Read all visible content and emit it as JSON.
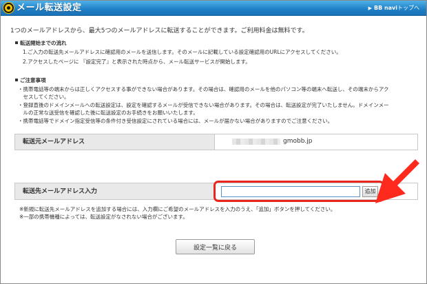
{
  "window": {
    "title": "メール転送設定",
    "top_link": {
      "arrow": "▶",
      "brand": "BB navi",
      "suffix": "トップへ"
    }
  },
  "intro": "1つのメールアドレスから、最大5つのメールアドレスに転送することができます。ご利用料金は無料です。",
  "flow": {
    "heading": "転送開始までの流れ",
    "steps": [
      "1.ご入力の転送先メールアドレスに確認用のメールを送信します。そのメールに記載している設定確認用のURLにアクセスしてください。",
      "2.アクセスしたページに 『設定完了』と表示された時点から、メール転送サービスが開始します。"
    ]
  },
  "cautions": {
    "heading": "ご注意事項",
    "lines": [
      "・携帯電話等の端末からは正しくアクセスする事ができない場合があります。その場合は、確認用のメールを他のパソコン等の端末へ転送し、その端末からアク",
      "　セスしてください。",
      "・登録直後のドメインメールへの転送設定は、設定を確認するメールが受信できない場合があります。その場合は、転送設定が完了いたしません。ドメインメー",
      "　ルの正常な送受信を確認した後に転送設定のお手続きをお願いいたします。",
      "・携帯電話等でドメイン指定受信等の条件付き受信設定にされている場合には、メールが届かない場合がありますのでご注意ください。"
    ]
  },
  "source_row": {
    "label": "転送元メールアドレス",
    "domain": "gmobb.jp"
  },
  "dest_row": {
    "label": "転送先メールアドレス入力",
    "input_value": "",
    "add_label": "追加"
  },
  "notes": [
    "※新規に転送先メールアドレスを追加する場合には、入力欄にご希望のメールアドレスを入力のうえ、「追加」ボタンを押してください。",
    "※一部の携帯機種によっては、転送設定がなされない場合がございます。"
  ],
  "return_button": "設定一覧に戻る",
  "colors": {
    "header": "#1f7fc6",
    "highlight": "#e8261c",
    "label_bg": "#e9e9e9"
  }
}
